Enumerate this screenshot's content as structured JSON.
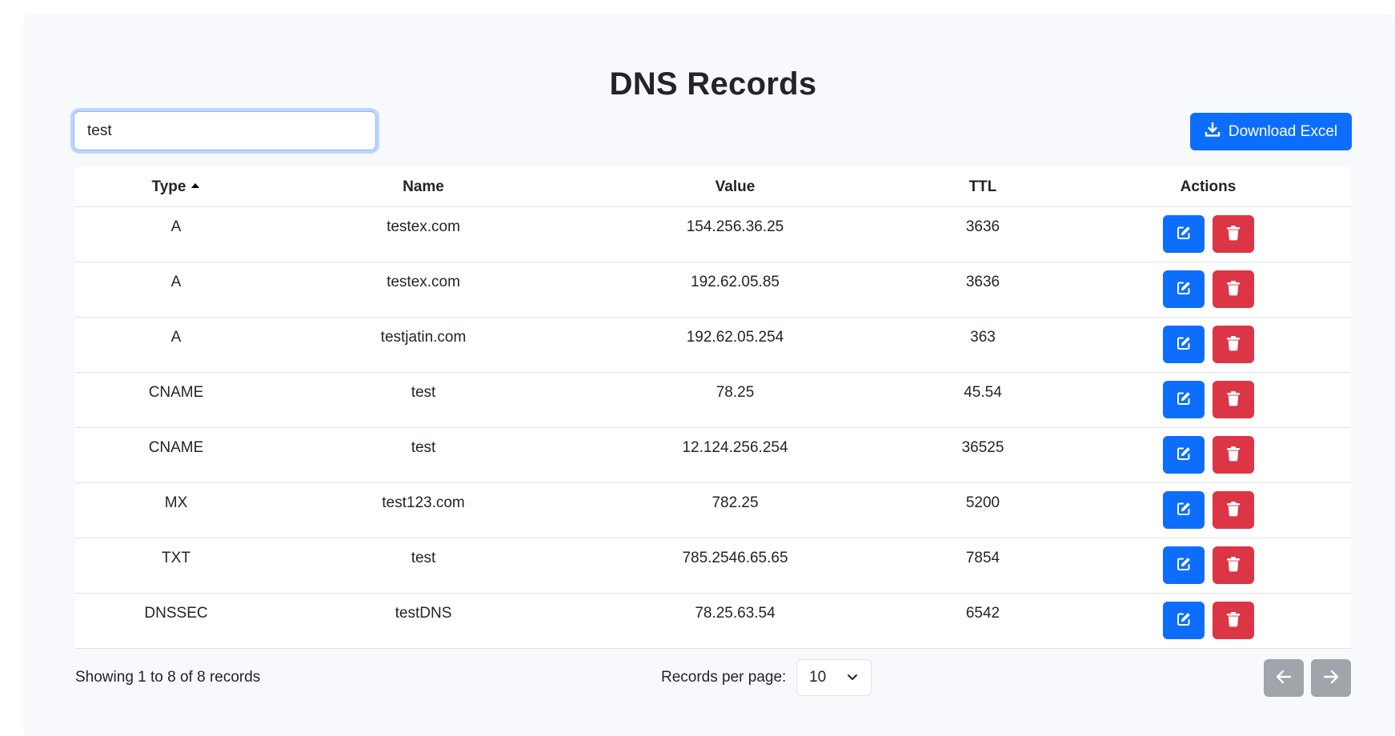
{
  "page": {
    "title": "DNS Records"
  },
  "search": {
    "value": "test"
  },
  "toolbar": {
    "download_label": "Download Excel"
  },
  "table": {
    "columns": [
      "Type",
      "Name",
      "Value",
      "TTL",
      "Actions"
    ],
    "sort": {
      "column": "Type",
      "direction": "ascending"
    },
    "rows": [
      {
        "type": "A",
        "name": "testex.com",
        "value": "154.256.36.25",
        "ttl": "3636"
      },
      {
        "type": "A",
        "name": "testex.com",
        "value": "192.62.05.85",
        "ttl": "3636"
      },
      {
        "type": "A",
        "name": "testjatin.com",
        "value": "192.62.05.254",
        "ttl": "363"
      },
      {
        "type": "CNAME",
        "name": "test",
        "value": "78.25",
        "ttl": "45.54"
      },
      {
        "type": "CNAME",
        "name": "test",
        "value": "12.124.256.254",
        "ttl": "36525"
      },
      {
        "type": "MX",
        "name": "test123.com",
        "value": "782.25",
        "ttl": "5200"
      },
      {
        "type": "TXT",
        "name": "test",
        "value": "785.2546.65.65",
        "ttl": "7854"
      },
      {
        "type": "DNSSEC",
        "name": "testDNS",
        "value": "78.25.63.54",
        "ttl": "6542"
      }
    ],
    "row_actions": {
      "edit_icon": "edit-icon",
      "delete_icon": "trash-icon"
    }
  },
  "footer": {
    "showing_text": "Showing 1 to 8 of 8 records",
    "records_per_page_label": "Records per page:",
    "records_per_page_value": "10",
    "prev_icon": "arrow-left-icon",
    "next_icon": "arrow-right-icon"
  },
  "colors": {
    "primary": "#0d6efd",
    "danger": "#dc3545",
    "secondary": "#a0a5ab",
    "card_background": "#f8f9fd"
  }
}
